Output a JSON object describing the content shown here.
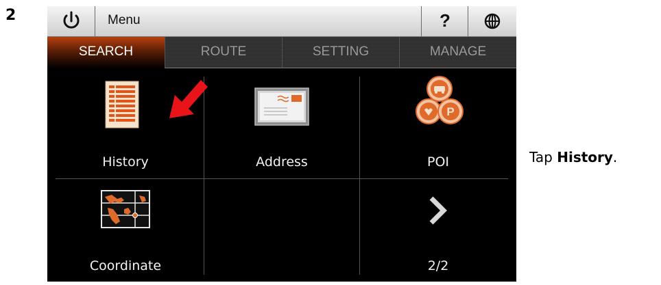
{
  "step": {
    "number": "2"
  },
  "instruction": {
    "prefix": "Tap ",
    "bold": "History",
    "suffix": "."
  },
  "topbar": {
    "power_icon": "power-icon",
    "menu_label": "Menu",
    "help_label": "?",
    "globe_icon": "globe-icon"
  },
  "tabs": [
    {
      "label": "SEARCH",
      "active": true
    },
    {
      "label": "ROUTE",
      "active": false
    },
    {
      "label": "SETTING",
      "active": false
    },
    {
      "label": "MANAGE",
      "active": false
    }
  ],
  "grid": {
    "items": [
      {
        "label": "History",
        "icon": "history-list-icon"
      },
      {
        "label": "Address",
        "icon": "envelope-icon"
      },
      {
        "label": "POI",
        "icon": "poi-icon"
      },
      {
        "label": "Coordinate",
        "icon": "map-coordinate-icon"
      },
      {
        "label": "",
        "icon": ""
      },
      {
        "label": "2/2",
        "icon": "next-page-chevron-icon"
      }
    ]
  },
  "annotation": {
    "arrow_icon": "red-pointer-arrow-icon"
  },
  "colors": {
    "accent": "#d85a1a",
    "arrow": "#e8141a",
    "screen_bg": "#000000"
  }
}
